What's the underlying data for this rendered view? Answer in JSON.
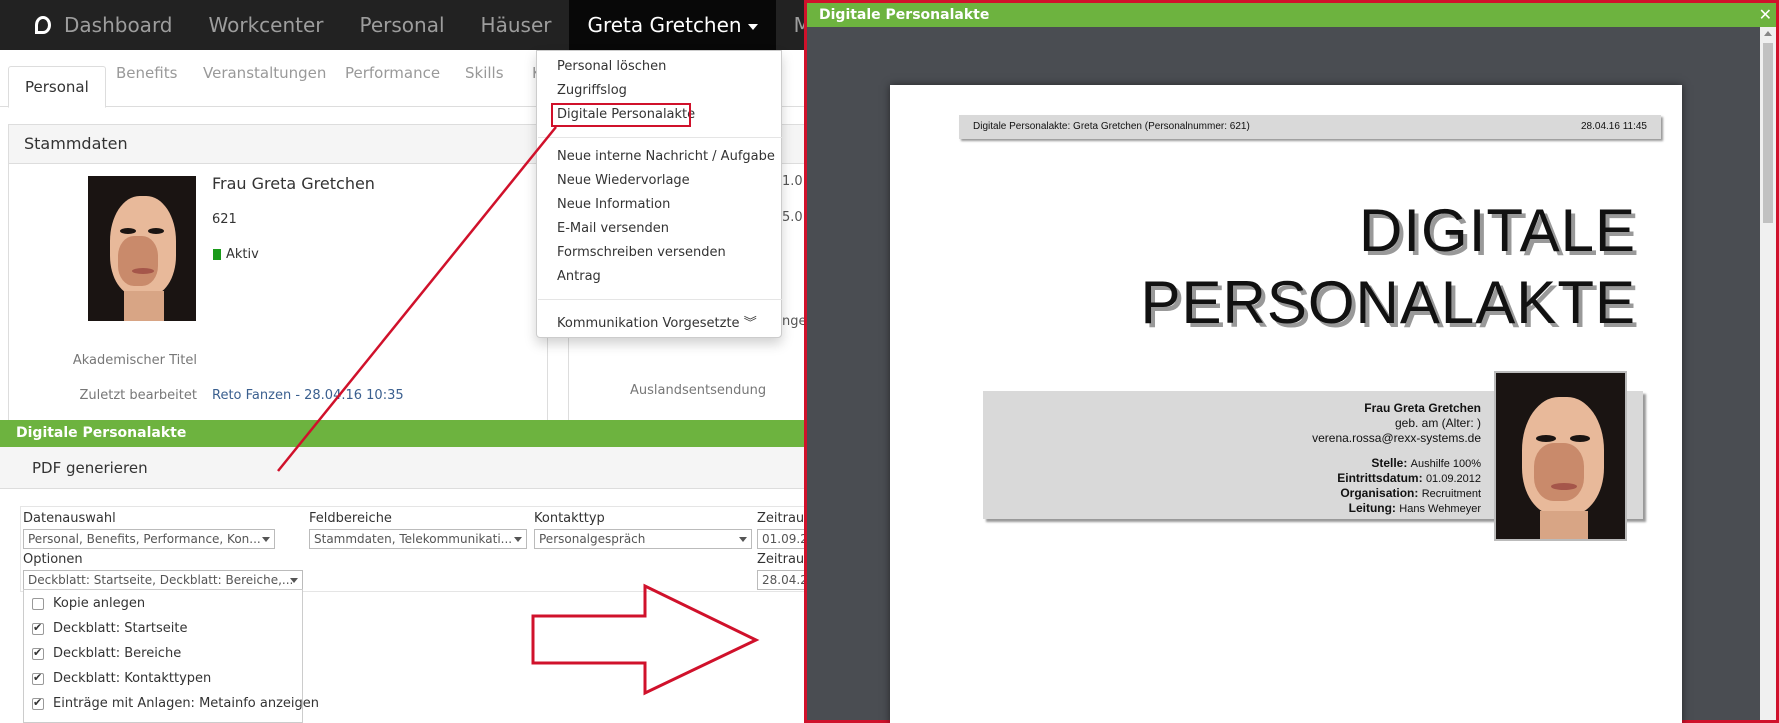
{
  "nav": {
    "items": [
      "Dashboard",
      "Workcenter",
      "Personal",
      "Häuser"
    ],
    "active_user": "Greta Gretchen",
    "next_user": "Mia Ziegle"
  },
  "tabs": [
    "Personal",
    "Benefits",
    "Veranstaltungen",
    "Performance",
    "Skills",
    "K"
  ],
  "stammdaten": {
    "title": "Stammdaten",
    "name": "Frau Greta Gretchen",
    "number": "621",
    "status": "Aktiv",
    "akad_label": "Akademischer Titel",
    "edited_label": "Zuletzt bearbeitet",
    "edited_value": "Reto Fanzen - 28.04.16 10:35",
    "right_clip_1": "1.0",
    "right_clip_2": "5.0",
    "right_clip_3": "nge",
    "ausland_label": "Auslandsentsendung"
  },
  "dropdown": {
    "items": [
      "Personal löschen",
      "Zugriffslog",
      "Digitale Personalakte",
      "Neue interne Nachricht / Aufgabe",
      "Neue Wiedervorlage",
      "Neue Information",
      "E-Mail versenden",
      "Formschreiben versenden",
      "Antrag",
      "Kommunikation Vorgesetzte"
    ]
  },
  "pdf_panel": {
    "title": "Digitale Personalakte",
    "generate": "PDF generieren",
    "datenauswahl_label": "Datenauswahl",
    "datenauswahl_value": "Personal, Benefits, Performance, Kon...",
    "feldbereiche_label": "Feldbereiche",
    "feldbereiche_value": "Stammdaten, Telekommunikati...",
    "kontakttyp_label": "Kontakttyp",
    "kontakttyp_value": "Personalgespräch",
    "zeitraum1_label": "Zeitraum",
    "zeitraum1_value": "01.09.2",
    "optionen_label": "Optionen",
    "optionen_value": "Deckblatt: Startseite, Deckblatt: Bereiche,...",
    "zeitraum2_label": "Zeitraum",
    "zeitraum2_value": "28.04.2",
    "options": [
      {
        "label": "Kopie anlegen",
        "checked": false
      },
      {
        "label": "Deckblatt: Startseite",
        "checked": true
      },
      {
        "label": "Deckblatt: Bereiche",
        "checked": true
      },
      {
        "label": "Deckblatt: Kontakttypen",
        "checked": true
      },
      {
        "label": "Einträge mit Anlagen: Metainfo anzeigen",
        "checked": true
      }
    ]
  },
  "modal": {
    "title": "Digitale Personalakte",
    "close": "✕",
    "pdf_header_left": "Digitale Personalakte: Greta Gretchen (Personalnummer: 621)",
    "pdf_header_right": "28.04.16 11:45",
    "pdf_title_1": "DIGITALE",
    "pdf_title_2": "PERSONALAKTE",
    "info_name": "Frau Greta Gretchen",
    "info_birth": "geb. am  (Alter: )",
    "info_email": "verena.rossa@rexx-systems.de",
    "stelle_label": "Stelle:",
    "stelle_value": "Aushilfe 100%",
    "eintritt_label": "Eintrittsdatum:",
    "eintritt_value": "01.09.2012",
    "org_label": "Organisation:",
    "org_value": "Recruitment",
    "leitung_label": "Leitung:",
    "leitung_value": "Hans Wehmeyer"
  },
  "colors": {
    "brand_red": "#d0112b",
    "green": "#6db33f",
    "nav_bg": "#222222"
  }
}
